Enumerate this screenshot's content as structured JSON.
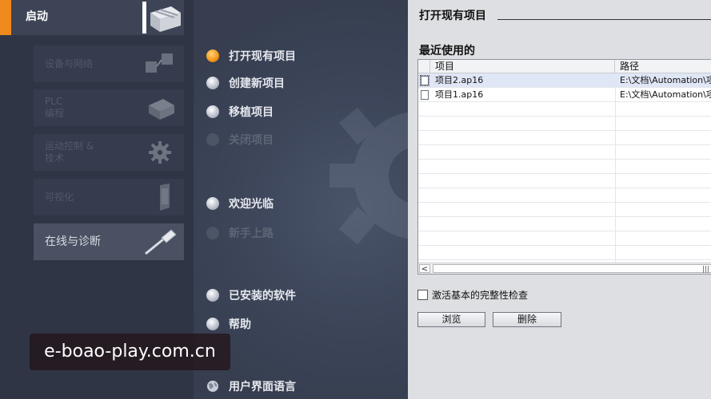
{
  "sidebar": {
    "start_tab": {
      "label": "启动",
      "icon": "portal-start-icon"
    },
    "items": [
      {
        "label": "设备与网络",
        "icon": "devices-network-icon",
        "enabled": false
      },
      {
        "label": "PLC\n编程",
        "icon": "plc-programming-icon",
        "enabled": false
      },
      {
        "label": "运动控制 &\n技术",
        "icon": "motion-gear-icon",
        "enabled": false
      },
      {
        "label": "可视化",
        "icon": "visualization-panel-icon",
        "enabled": false
      },
      {
        "label": "在线与诊断",
        "icon": "screwdriver-icon",
        "enabled": true
      }
    ]
  },
  "menu": {
    "items": [
      {
        "label": "打开现有项目",
        "active": true,
        "enabled": true
      },
      {
        "label": "创建新项目",
        "active": false,
        "enabled": true
      },
      {
        "label": "移植项目",
        "active": false,
        "enabled": true
      },
      {
        "label": "关闭项目",
        "active": false,
        "enabled": false
      },
      {
        "label": "欢迎光临",
        "active": false,
        "enabled": true
      },
      {
        "label": "新手上路",
        "active": false,
        "enabled": false
      },
      {
        "label": "已安装的软件",
        "active": false,
        "enabled": true
      },
      {
        "label": "帮助",
        "active": false,
        "enabled": true
      },
      {
        "label": "用户界面语言",
        "active": false,
        "enabled": true,
        "icon": "globe-icon"
      }
    ]
  },
  "right": {
    "title": "打开现有项目",
    "recent_label": "最近使用的",
    "table": {
      "columns": [
        "项目",
        "路径"
      ],
      "rows": [
        {
          "name": "项目2.ap16",
          "path": "E:\\文档\\Automation\\项",
          "selected": true
        },
        {
          "name": "项目1.ap16",
          "path": "E:\\文档\\Automation\\项",
          "selected": false
        }
      ],
      "scroll_left": "<",
      "scroll_grip": "|||"
    },
    "integrity_check_label": "激活基本的完整性检查",
    "browse_label": "浏览",
    "delete_label": "删除"
  },
  "watermark": "e-boao-play.com.cn",
  "colors": {
    "accent": "#f08a1c",
    "sidebar_bg": "#2f3545",
    "right_bg": "#dedfe2"
  }
}
